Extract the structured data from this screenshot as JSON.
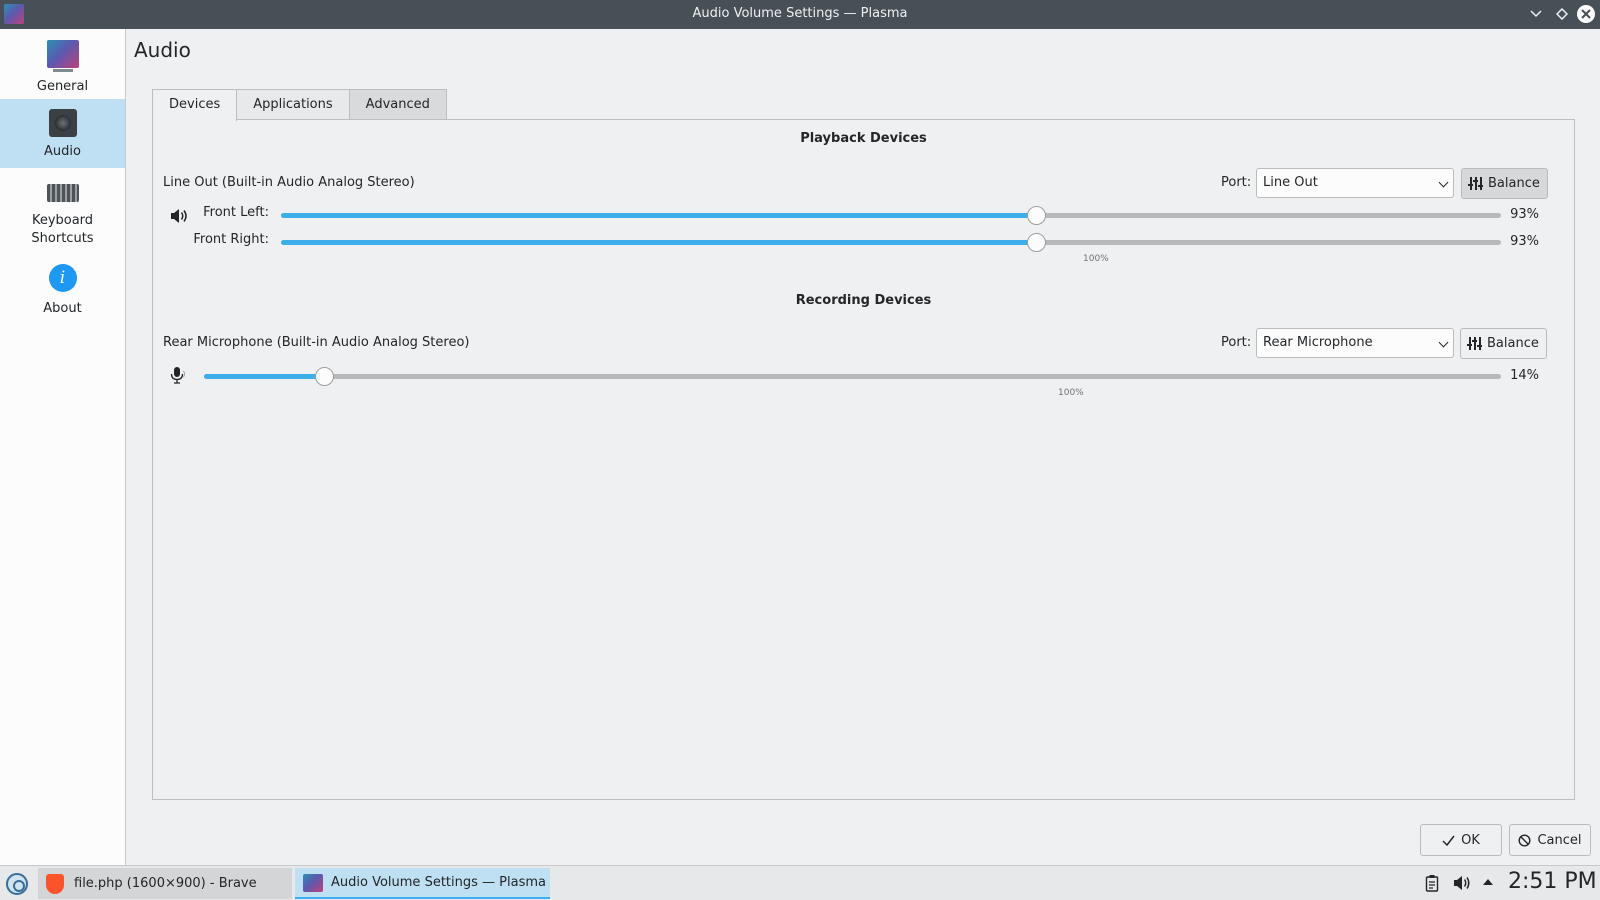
{
  "window": {
    "title": "Audio Volume Settings — Plasma"
  },
  "sidebar": {
    "items": [
      {
        "label": "General",
        "icon": "general-icon"
      },
      {
        "label": "Audio",
        "icon": "speaker-icon",
        "active": true
      },
      {
        "label": "Keyboard",
        "label2": "Shortcuts",
        "icon": "keyboard-icon"
      },
      {
        "label": "About",
        "icon": "info-icon"
      }
    ]
  },
  "page": {
    "title": "Audio",
    "tabs": [
      "Devices",
      "Applications",
      "Advanced"
    ],
    "active_tab": "Devices"
  },
  "playback": {
    "header": "Playback Devices",
    "device_name": "Line Out (Built-in Audio Analog Stereo)",
    "port_label": "Port:",
    "port_value": "Line Out",
    "balance_label": "Balance",
    "balance_pressed": true,
    "channels": [
      {
        "label": "Front Left:",
        "percent_text": "93%",
        "level": 0.93
      },
      {
        "label": "Front Right:",
        "percent_text": "93%",
        "level": 0.93
      }
    ],
    "tick_label": "100%"
  },
  "recording": {
    "header": "Recording Devices",
    "device_name": "Rear Microphone (Built-in Audio Analog Stereo)",
    "port_label": "Port:",
    "port_value": "Rear Microphone",
    "balance_label": "Balance",
    "volume_text": "14%",
    "level": 0.14,
    "tick_label": "100%"
  },
  "dialog": {
    "ok_label": "OK",
    "cancel_label": "Cancel"
  },
  "taskbar": {
    "tasks": [
      {
        "label": "file.php (1600×900) - Brave",
        "icon": "brave-icon"
      },
      {
        "label": "Audio Volume Settings — Plasma",
        "icon": "plasma-icon",
        "active": true
      }
    ],
    "clock": "2:51 PM"
  },
  "colors": {
    "accent": "#3daee9",
    "selection": "#bfdff2",
    "titlebar": "#475057"
  }
}
